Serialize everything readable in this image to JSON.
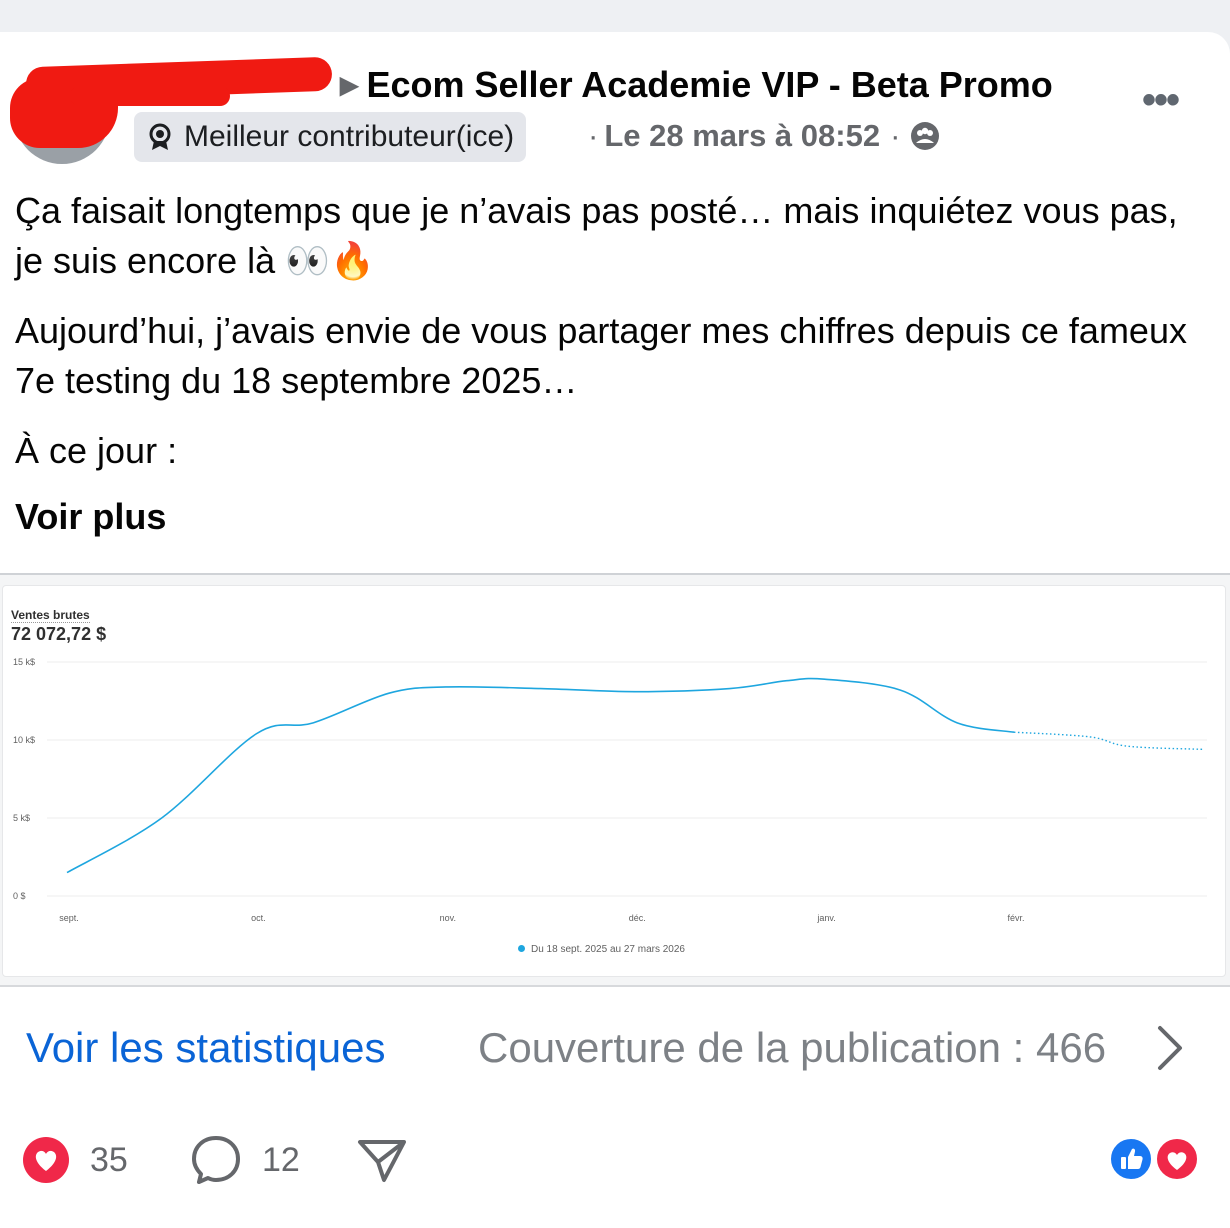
{
  "post": {
    "group_name": "Ecom Seller Academie VIP - Beta Promo",
    "badge_label": "Meilleur contributeur(ice)",
    "timestamp": "Le 28 mars à 08:52",
    "paragraphs": [
      "Ça faisait longtemps que je n’avais pas posté… mais inquiétez vous pas, je suis encore là 👀🔥",
      "Aujourd’hui, j’avais envie de vous partager mes chiffres depuis ce fameux 7e testing du 18 septembre 2025…",
      "À ce jour :"
    ],
    "see_more": "Voir plus"
  },
  "chart_data": {
    "type": "line",
    "metric_label": "Ventes brutes",
    "total": "72 072,72 $",
    "y_ticks": [
      "15 k$",
      "10 k$",
      "5 k$",
      "0 $"
    ],
    "ylim": [
      0,
      15000
    ],
    "x_ticks": [
      "sept.",
      "oct.",
      "nov.",
      "déc.",
      "janv.",
      "févr."
    ],
    "series": [
      {
        "name": "Du 18 sept. 2025 au 27 mars 2026",
        "color": "#1ea6df",
        "points": [
          [
            "sept.",
            1500
          ],
          [
            0.5,
            5000
          ],
          [
            "oct.",
            10400
          ],
          [
            1.3,
            11100
          ],
          [
            1.7,
            13000
          ],
          [
            "nov.",
            13400
          ],
          [
            2.5,
            13300
          ],
          [
            "déc.",
            13100
          ],
          [
            3.5,
            13300
          ],
          [
            3.8,
            13800
          ],
          [
            "janv.",
            13900
          ],
          [
            4.4,
            13200
          ],
          [
            4.7,
            11100
          ],
          [
            "févr.",
            10500
          ]
        ],
        "projected_points": [
          [
            "févr.",
            10500
          ],
          [
            5.4,
            10200
          ],
          [
            5.6,
            9600
          ],
          [
            6.0,
            9400
          ]
        ]
      }
    ],
    "legend_position": "bottom"
  },
  "stats": {
    "link_label": "Voir les statistiques",
    "reach_label": "Couverture de la publication : 466"
  },
  "actions": {
    "likes": "35",
    "comments": "12"
  },
  "colors": {
    "link_blue": "#0a64d6",
    "chart_line": "#1ea6df",
    "love_red": "#f02849",
    "like_blue": "#1877f2"
  }
}
